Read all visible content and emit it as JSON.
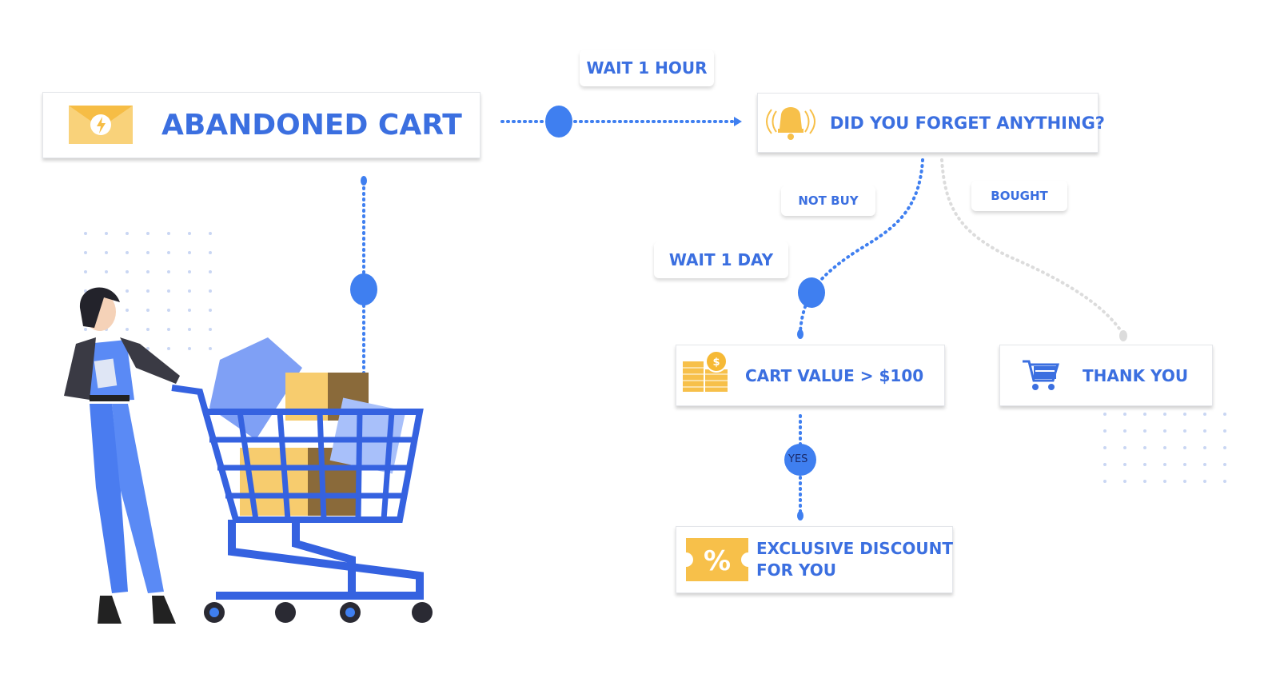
{
  "nodes": {
    "start": {
      "label": "ABANDONED CART",
      "icon": "lightning-envelope-icon"
    },
    "reminder": {
      "label": "DID YOU FORGET ANYTHING?",
      "icon": "bell-icon"
    },
    "condition": {
      "label": "CART VALUE > $100",
      "icon": "coins-icon"
    },
    "thanks": {
      "label": "THANK YOU",
      "icon": "shopping-cart-icon"
    },
    "discount": {
      "label_line1": "EXCLUSIVE DISCOUNT",
      "label_line2": "FOR YOU",
      "icon": "percent-ticket-icon"
    }
  },
  "edges": {
    "wait_hour": "WAIT 1 HOUR",
    "not_buy": "NOT BUY",
    "bought": "BOUGHT",
    "wait_day": "WAIT 1 DAY",
    "yes": "YES"
  },
  "colors": {
    "accent": "#3b6fe0",
    "node": "#3f7ff0",
    "yellow": "#f7c04a",
    "grey_path": "#dcdcdc"
  }
}
